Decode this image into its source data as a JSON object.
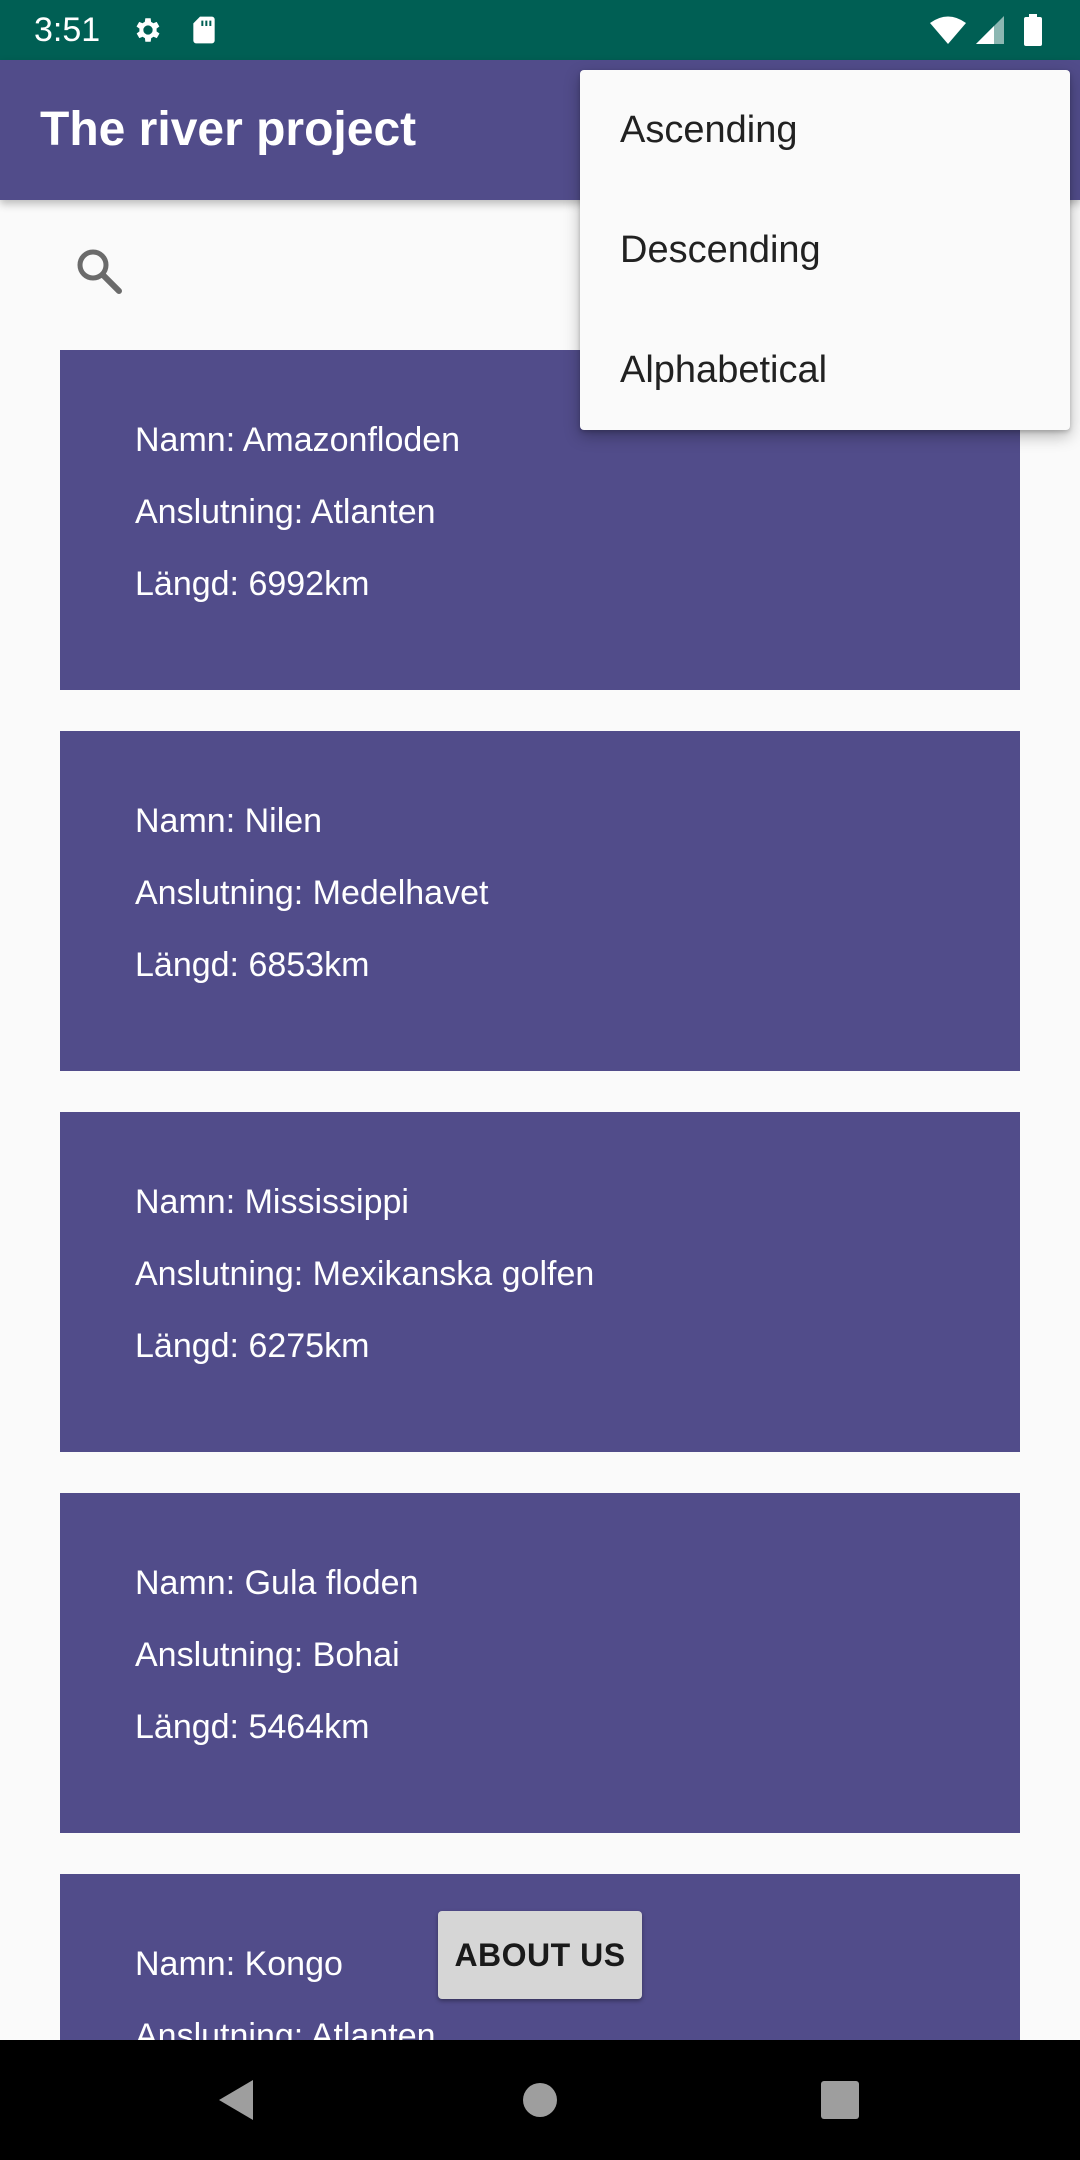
{
  "status_bar": {
    "time": "3:51",
    "left_icons": [
      "gear-icon",
      "sd-card-icon"
    ],
    "right_icons": [
      "wifi-icon",
      "signal-icon",
      "battery-icon"
    ],
    "background": "#005f54"
  },
  "app_bar": {
    "title": "The river project",
    "background": "#514c8a"
  },
  "search": {
    "icon": "search-icon"
  },
  "sort_menu": {
    "items": [
      "Ascending",
      "Descending",
      "Alphabetical"
    ]
  },
  "rivers": [
    {
      "name": "Namn: Amazonfloden",
      "connection": "Anslutning: Atlanten",
      "length": "Längd: 6992km"
    },
    {
      "name": "Namn: Nilen",
      "connection": "Anslutning: Medelhavet",
      "length": "Längd: 6853km"
    },
    {
      "name": "Namn: Mississippi",
      "connection": "Anslutning: Mexikanska golfen",
      "length": "Längd: 6275km"
    },
    {
      "name": "Namn: Gula floden",
      "connection": "Anslutning: Bohai",
      "length": "Längd: 5464km"
    },
    {
      "name": "Namn: Kongo",
      "connection": "Anslutning: Atlanten",
      "length": ""
    }
  ],
  "about_button": {
    "label": "ABOUT US"
  },
  "nav_bar": {
    "buttons": [
      "back-icon",
      "home-icon",
      "recents-icon"
    ]
  },
  "colors": {
    "card": "#514c8a",
    "page_background": "#fafafa",
    "menu_background": "#fafafa"
  }
}
